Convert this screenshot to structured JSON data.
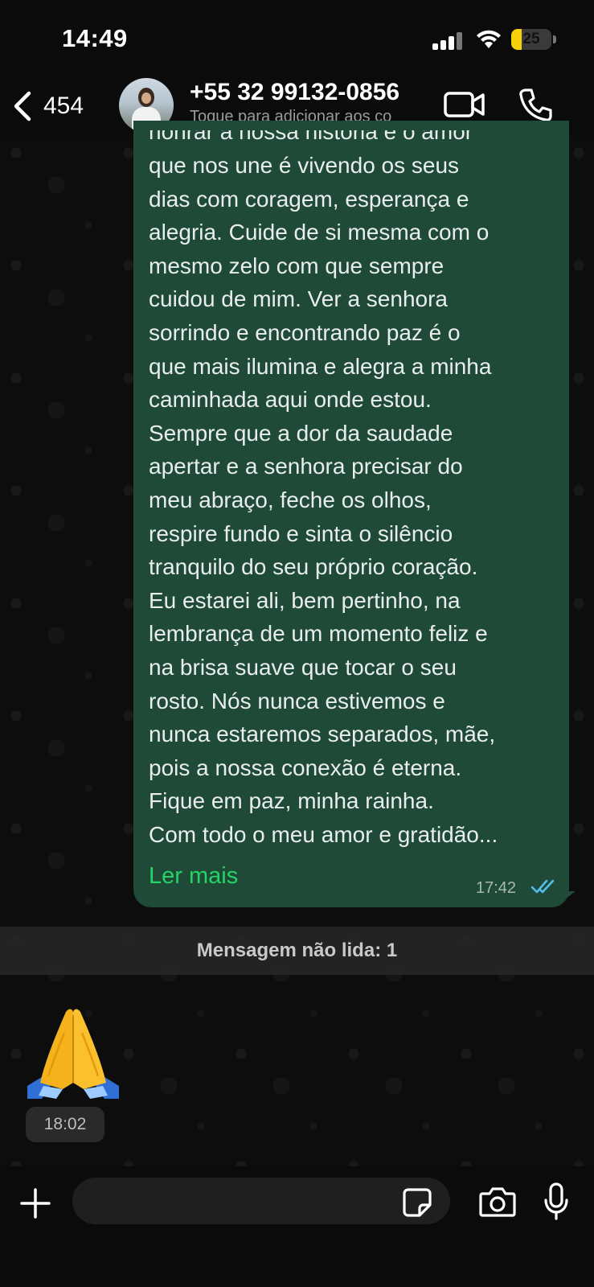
{
  "status_bar": {
    "time": "14:49",
    "battery": "25",
    "battery_percent": 25,
    "battery_color": "#f5d20a"
  },
  "header": {
    "back_count": "454",
    "contact_name": "+55 32 99132-0856",
    "contact_subtitle": "Toque para adicionar aos co",
    "icons": [
      "chevron-left-icon",
      "video-camera-icon",
      "phone-icon"
    ]
  },
  "message": {
    "partial_first_line": "honrar a nossa história e o amor",
    "lines": [
      "que nos une é vivendo os seus",
      "dias com coragem, esperança e",
      "alegria. Cuide de si mesma com o",
      "mesmo zelo com que sempre",
      "cuidou de mim. Ver a senhora",
      "sorrindo e encontrando paz é o",
      "que mais ilumina e alegra a minha",
      "caminhada aqui onde estou.",
      "Sempre que a dor da saudade",
      "apertar e a senhora precisar do",
      "meu abraço, feche os olhos,",
      "respire fundo e sinta o silêncio",
      "tranquilo do seu próprio coração.",
      "Eu estarei ali, bem pertinho, na",
      "lembrança de um momento feliz e",
      "na brisa suave que tocar o seu",
      "rosto. Nós nunca estivemos e",
      "nunca estaremos separados, mãe,",
      "pois a nossa conexão é eterna.",
      "Fique em paz, minha rainha.",
      "Com todo o meu amor e gratidão..."
    ],
    "read_more": "Ler mais",
    "time": "17:42",
    "status": "read",
    "bubble_color": "#1e4a37",
    "link_color": "#25d366",
    "read_check_color": "#53bdeb"
  },
  "unread": {
    "label": "Mensagem não lida: 1"
  },
  "incoming": {
    "emoji": "folded-hands-emoji",
    "time": "18:02"
  },
  "composer": {
    "placeholder": "",
    "icons": [
      "plus-icon",
      "sticker-icon",
      "camera-icon",
      "microphone-icon"
    ]
  }
}
